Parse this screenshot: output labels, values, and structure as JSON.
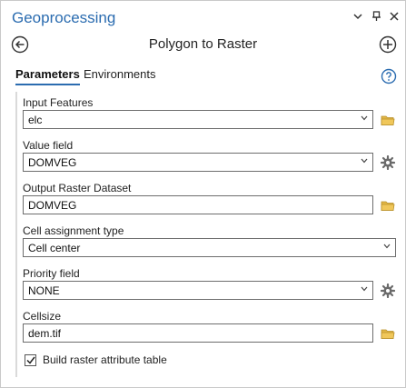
{
  "pane": {
    "title": "Geoprocessing"
  },
  "window_controls": [
    {
      "name": "dropdown-icon",
      "glyph": "▾"
    },
    {
      "name": "pin-icon",
      "glyph": "⊓"
    },
    {
      "name": "close-icon",
      "glyph": "✕"
    }
  ],
  "tool": {
    "name": "Polygon to Raster"
  },
  "tabs": {
    "parameters": "Parameters",
    "environments": "Environments"
  },
  "params": {
    "input_features": {
      "label": "Input Features",
      "value": "elc"
    },
    "value_field": {
      "label": "Value field",
      "value": "DOMVEG"
    },
    "output_raster": {
      "label": "Output Raster Dataset",
      "value": "DOMVEG"
    },
    "cell_assignment": {
      "label": "Cell assignment type",
      "value": "Cell center"
    },
    "priority_field": {
      "label": "Priority field",
      "value": "NONE"
    },
    "cellsize": {
      "label": "Cellsize",
      "value": "dem.tif"
    },
    "build_rat": {
      "label": "Build raster attribute table",
      "checked": true
    }
  },
  "colors": {
    "accent": "#2b6cb0",
    "folder": "#e2b646",
    "gear": "#6b6b6b"
  }
}
